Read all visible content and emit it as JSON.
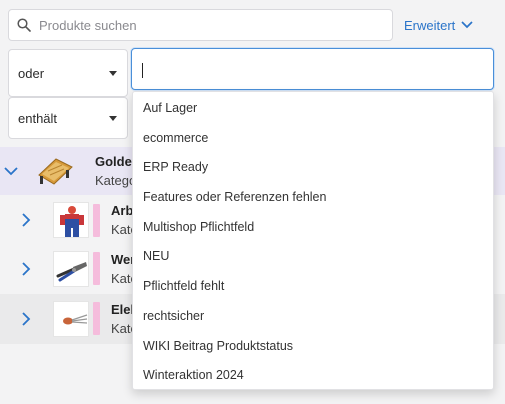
{
  "search": {
    "placeholder": "Produkte suchen"
  },
  "advanced": {
    "label": "Erweitert"
  },
  "filter": {
    "logic_value": "oder",
    "operator_value": "enthält",
    "tag_input_value": ""
  },
  "tags_dropdown": {
    "options": [
      "Auf Lager",
      "ecommerce",
      "ERP Ready",
      "Features oder Referenzen fehlen",
      "Multishop Pflichtfeld",
      "NEU",
      "Pflichtfeld fehlt",
      "rechtsicher",
      "WIKI Beitrag Produktstatus",
      "Winteraktion 2024"
    ]
  },
  "products": [
    {
      "title": "Golden",
      "subtitle": "Katego",
      "expanded": true
    },
    {
      "title": "Arb",
      "subtitle": "Kate"
    },
    {
      "title": "Wer",
      "subtitle": "Kate"
    },
    {
      "title": "Elek",
      "subtitle": "Kate"
    }
  ],
  "colors": {
    "accent": "#2a74c9",
    "tag_pink": "#f5bcdc",
    "selected_row": "#e9e6f4"
  }
}
